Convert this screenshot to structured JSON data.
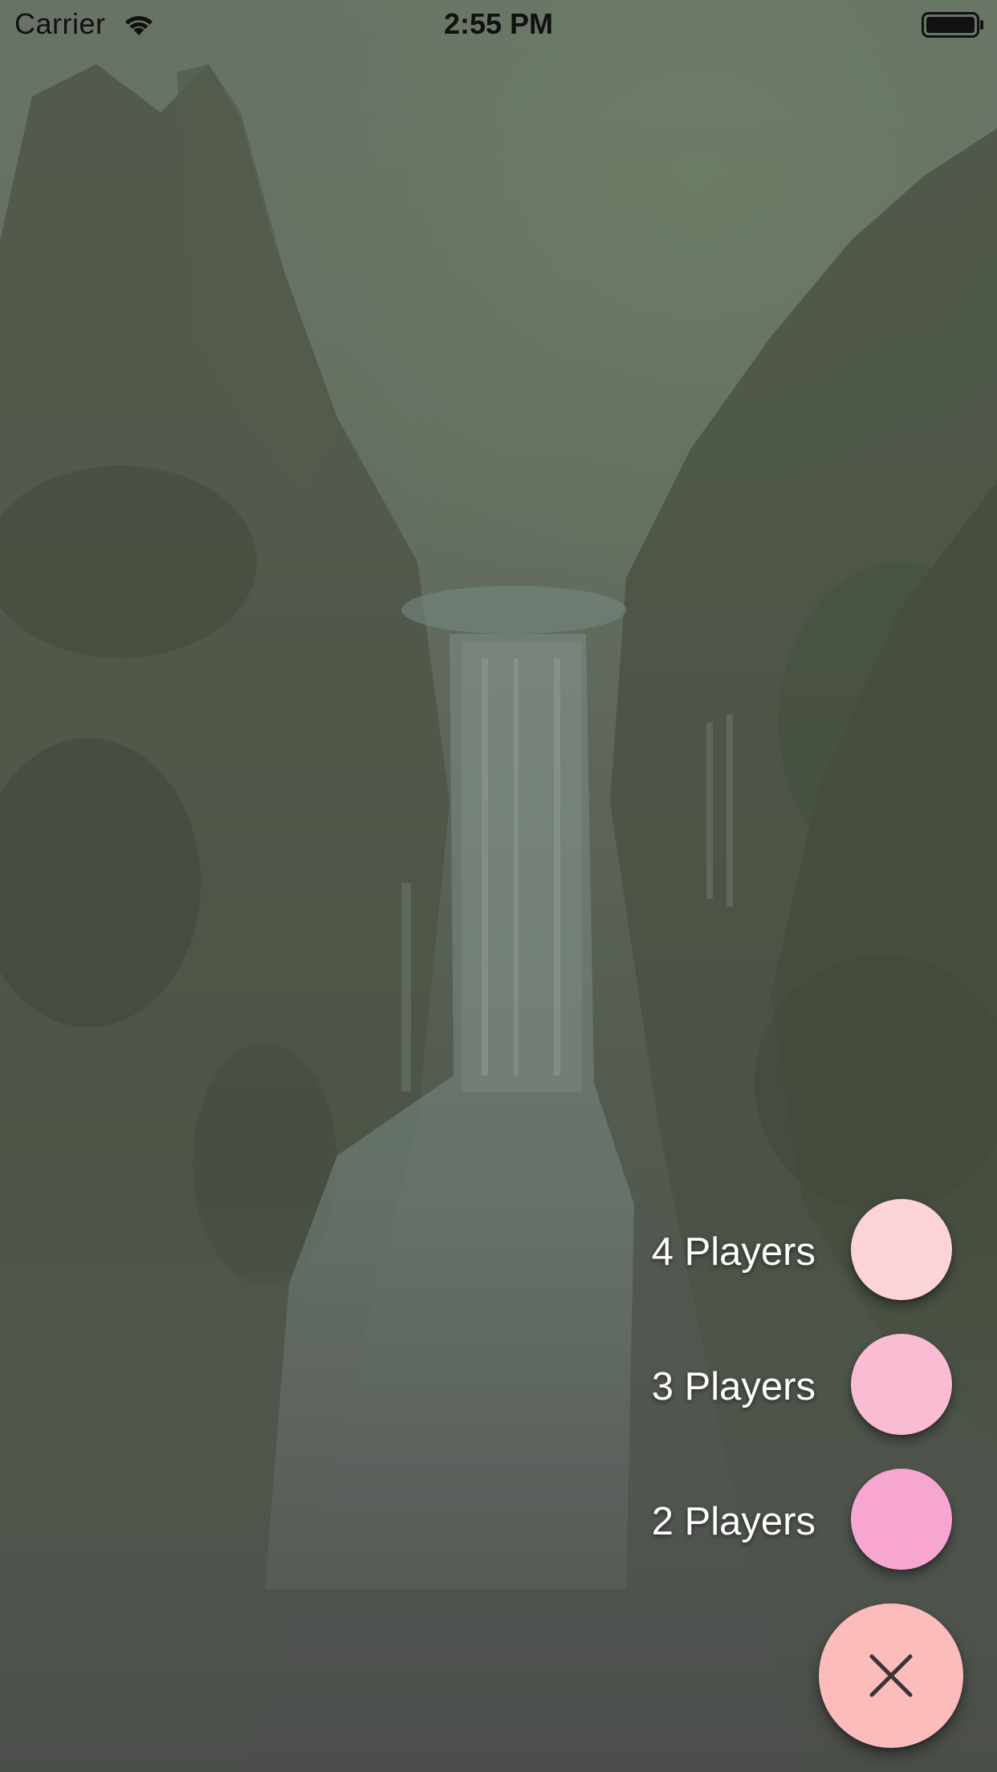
{
  "status_bar": {
    "carrier": "Carrier",
    "time": "2:55 PM",
    "icons": [
      "wifi-icon",
      "battery-icon"
    ]
  },
  "speed_dial": {
    "options": [
      {
        "label": "4 Players",
        "color": "#fcd3d6"
      },
      {
        "label": "3 Players",
        "color": "#f9bcd2"
      },
      {
        "label": "2 Players",
        "color": "#f7a6d1"
      }
    ],
    "close_button": {
      "icon": "close-icon",
      "color": "#fcbcbb"
    }
  },
  "background": {
    "description_icon": "waterfall-landscape-image"
  }
}
